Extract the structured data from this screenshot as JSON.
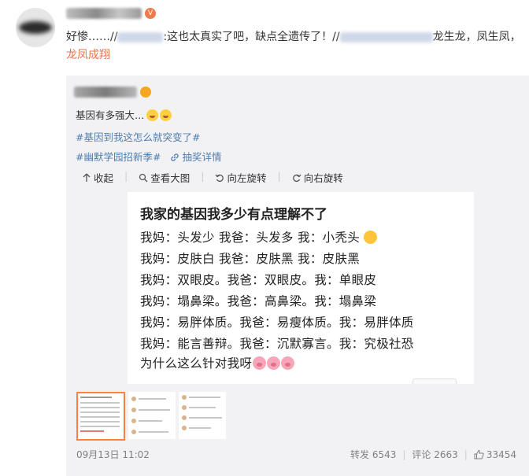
{
  "post": {
    "author_badge": "V",
    "text_prefix": "好惨……//",
    "text_mid": ":这也太真实了吧，缺点全遗传了！//",
    "text_suffix": "龙生龙，凤生凤，",
    "highlight": "龙凤成翔"
  },
  "repost": {
    "line1": "基因有多强大…",
    "hashtag1": "#基因到我这怎么就突变了#",
    "hashtag2": "#幽默学园招新季#",
    "lottery": "抽奖详情",
    "toolbar": {
      "collapse": "收起",
      "view_large": "查看大图",
      "rotate_left": "向左旋转",
      "rotate_right": "向右旋转"
    },
    "card": {
      "title": "我家的基因我多少有点理解不了",
      "lines": [
        "我妈：头发少  我爸：头发多  我：小秃头",
        "我妈：皮肤白  我爸：皮肤黑   我：皮肤黑",
        "我妈：双眼皮。我爸：双眼皮。我：单眼皮",
        "我妈：塌鼻梁。我爸：高鼻梁。我：塌鼻梁",
        "我妈：易胖体质。我爸：易瘦体质。我：易胖体质",
        "我妈：能言善辩。我爸：沉默寡言。我：究极社恐",
        "为什么这么针对我呀"
      ]
    },
    "footer": {
      "time": "09月13日 11:02",
      "repost": "转发 6543",
      "comment": "评论 2663",
      "likes": "33454"
    }
  }
}
